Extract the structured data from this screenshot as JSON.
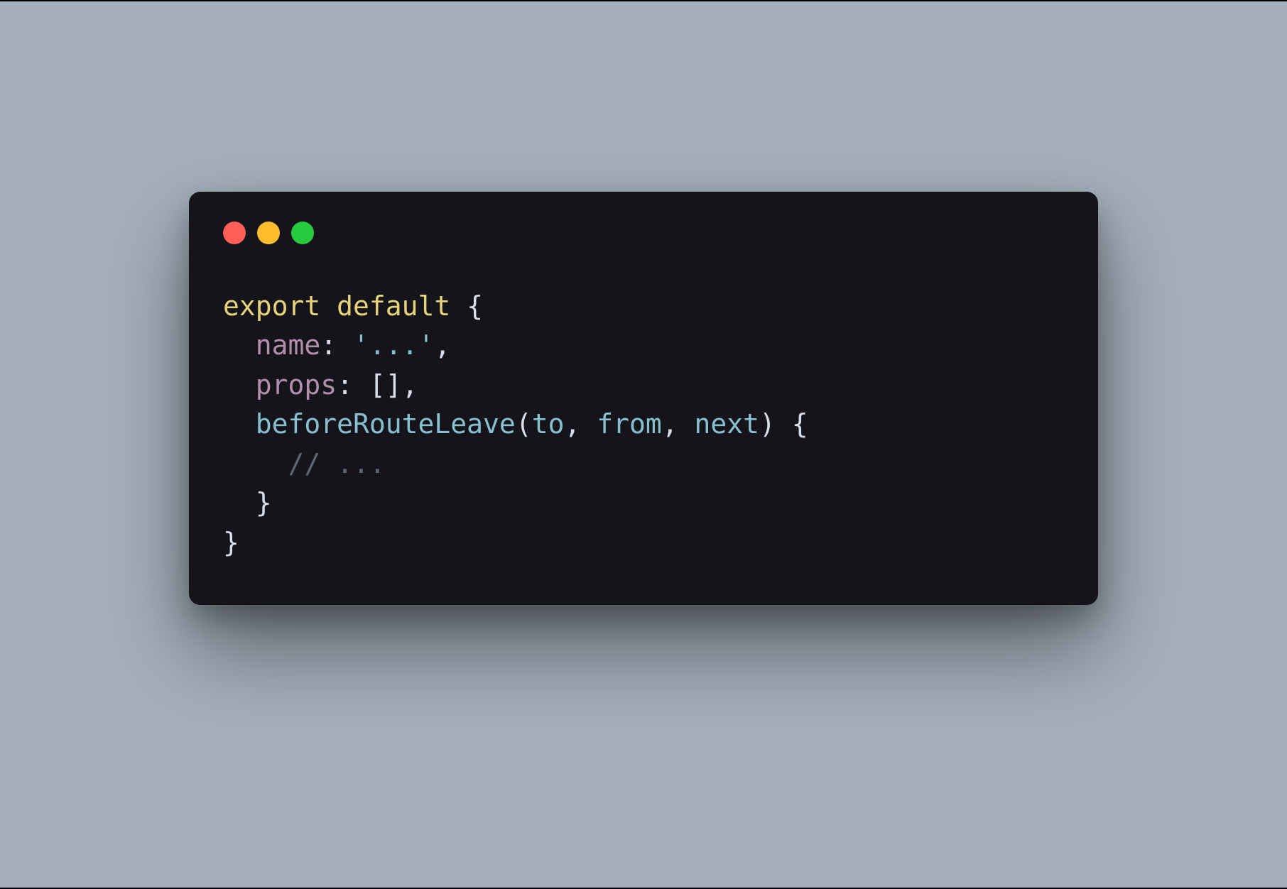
{
  "colors": {
    "background": "#a5b0bc",
    "window": "#14141a",
    "red": "#ff5f56",
    "yellow": "#ffbd2e",
    "green": "#27c93f",
    "keyword": "#e7d47a",
    "property": "#b48ead",
    "function": "#88c0d0",
    "string": "#88c0d0",
    "punctuation": "#d8dee9",
    "comment": "#5c6773"
  },
  "code": {
    "line1": {
      "export_default": "export default",
      "brace_open": " {"
    },
    "line2": {
      "indent": "  ",
      "name_key": "name",
      "colon_space": ": ",
      "name_value": "'...'",
      "comma": ","
    },
    "line3": {
      "indent": "  ",
      "props_key": "props",
      "colon_space": ": ",
      "props_value": "[]",
      "comma": ","
    },
    "line4": {
      "indent": "  ",
      "fn_name": "beforeRouteLeave",
      "paren_open": "(",
      "param_to": "to",
      "sep1": ", ",
      "param_from": "from",
      "sep2": ", ",
      "param_next": "next",
      "paren_close_brace": ") {"
    },
    "line5": {
      "indent": "    ",
      "comment": "// ..."
    },
    "line6": {
      "indent": "  ",
      "brace_close": "}"
    },
    "line7": {
      "brace_close": "}"
    }
  }
}
